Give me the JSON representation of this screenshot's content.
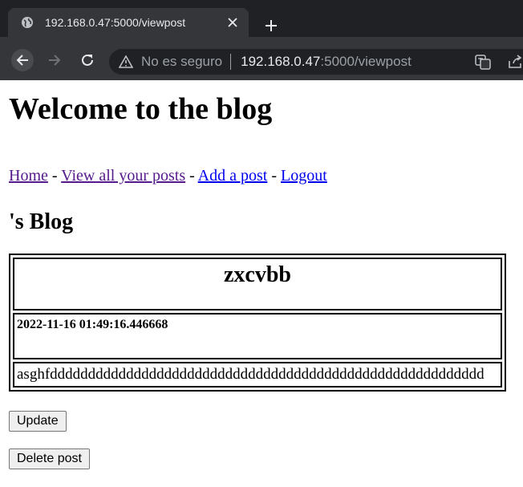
{
  "browser": {
    "tab_title": "192.168.0.47:5000/viewpost",
    "security_text": "No es seguro",
    "url_host": "192.168.0.47",
    "url_rest": ":5000/viewpost"
  },
  "page": {
    "site_title": "Welcome to the blog",
    "nav": {
      "home": "Home",
      "sep1": " - ",
      "view_all": "View all your posts",
      "sep2": " - ",
      "add_post": "Add a post",
      "sep3": " - ",
      "logout": "Logout"
    },
    "blog_heading": "'s Blog",
    "post": {
      "title": "zxcvbb",
      "date": "2022-11-16 01:49:16.446668",
      "body": "asghfddddddddddddddddddddddddddddddddddddddddddddddddddddddddd"
    },
    "buttons": {
      "update": "Update",
      "delete": "Delete post"
    }
  }
}
